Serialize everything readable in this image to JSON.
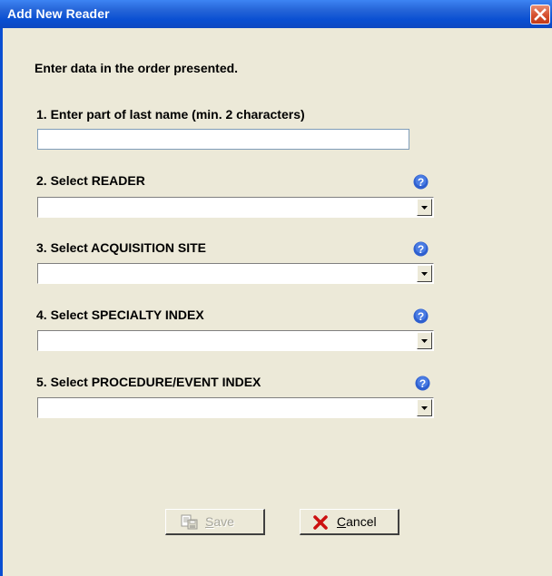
{
  "window": {
    "title": "Add New Reader"
  },
  "form": {
    "instruction": "Enter data in the order presented.",
    "last_name": {
      "label": "1. Enter part of last name (min. 2 characters)",
      "value": ""
    },
    "reader": {
      "label": "2. Select READER",
      "value": ""
    },
    "acquisition_site": {
      "label": "3. Select ACQUISITION SITE",
      "value": ""
    },
    "specialty_index": {
      "label": "4. Select SPECIALTY INDEX",
      "value": ""
    },
    "procedure_event_index": {
      "label": "5. Select PROCEDURE/EVENT INDEX",
      "value": ""
    }
  },
  "buttons": {
    "save": {
      "label": "Save",
      "enabled": false
    },
    "cancel": {
      "label": "Cancel",
      "enabled": true
    }
  },
  "icons": {
    "close": "close-icon",
    "help": "help-icon",
    "save": "save-icon",
    "cancel": "red-x-icon"
  },
  "colors": {
    "title_bar": "#0a4fd2",
    "dialog_background": "#ece9d8",
    "close_button": "#d5502f",
    "help_icon": "#2e5fcf",
    "cancel_x": "#cc1010"
  }
}
